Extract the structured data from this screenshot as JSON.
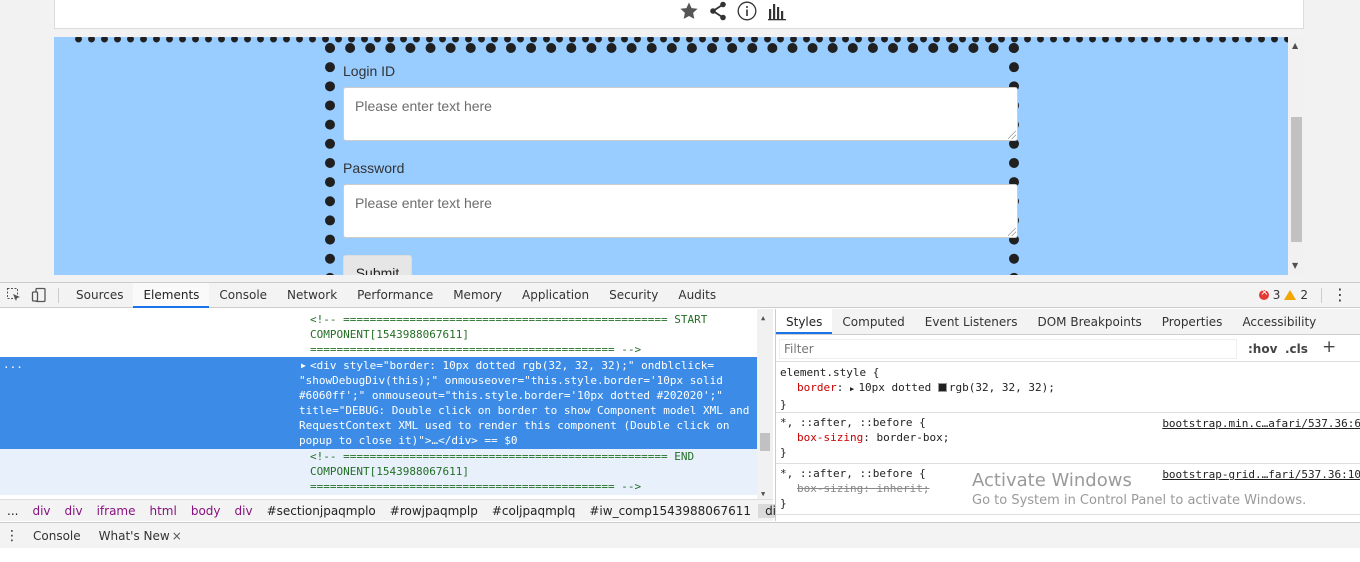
{
  "page": {
    "top_icons": [
      "star-icon",
      "share-icon",
      "info-icon",
      "bar-chart-icon"
    ],
    "form": {
      "login_label": "Login ID",
      "login_placeholder": "Please enter text here",
      "password_label": "Password",
      "password_placeholder": "Please enter text here",
      "submit_label": "Submit"
    }
  },
  "devtools": {
    "tabs": [
      "Sources",
      "Elements",
      "Console",
      "Network",
      "Performance",
      "Memory",
      "Application",
      "Security",
      "Audits"
    ],
    "active_tab": "Elements",
    "errors": "3",
    "warnings": "2",
    "elements": {
      "top_ellipsis": "...",
      "start_comment": "<!-- ================================================= START\nCOMPONENT[1543988067611]\n============================================== -->",
      "selected_line": "<div style=\"border: 10px dotted rgb(32, 32, 32);\" ondblclick=\n\"showDebugDiv(this);\" onmouseover=\"this.style.border='10px solid\n#6060ff';\" onmouseout=\"this.style.border='10px dotted #202020';\"\ntitle=\"DEBUG: Double click on border to show Component model XML and\nRequestContext XML used to render this component (Double click on\npopup to close it)\">…</div> == $0",
      "end_comment": "<!-- ================================================= END\nCOMPONENT[1543988067611]\n============================================== -->"
    },
    "breadcrumbs": [
      "...",
      "div",
      "div",
      "iframe",
      "html",
      "body",
      "div",
      "#sectionjpaqmplo",
      "#rowjpaqmplp",
      "#coljpaqmplq",
      "#iw_comp1543988067611",
      "div"
    ],
    "styles": {
      "tabs": [
        "Styles",
        "Computed",
        "Event Listeners",
        "DOM Breakpoints",
        "Properties",
        "Accessibility"
      ],
      "active_tab": "Styles",
      "filter_placeholder": "Filter",
      "hov": ":hov",
      "cls": ".cls",
      "plus": "+",
      "rules": [
        {
          "selector": "element.style {",
          "prop": "border",
          "value": "10px dotted ",
          "color_value": "rgb(32, 32, 32);",
          "close": "}"
        },
        {
          "selector": "*, ::after, ::before {",
          "source": "bootstrap.min.c…afari/537.36:6",
          "prop": "box-sizing",
          "value": "border-box;",
          "close": "}"
        },
        {
          "selector": "*, ::after, ::before {",
          "source": "bootstrap-grid.…fari/537.36:10",
          "prop": "box-sizing",
          "value": "inherit;",
          "close": "}"
        }
      ],
      "watermark_title": "Activate Windows",
      "watermark_sub": "Go to System in Control Panel to activate Windows."
    },
    "drawer": {
      "tabs": [
        "Console",
        "What's New"
      ],
      "close": "×"
    }
  },
  "colors": {
    "page_blue": "#99ccff",
    "selected_row": "#3c8ce7",
    "border_dots": "#202020",
    "accent": "#1a73e8"
  }
}
